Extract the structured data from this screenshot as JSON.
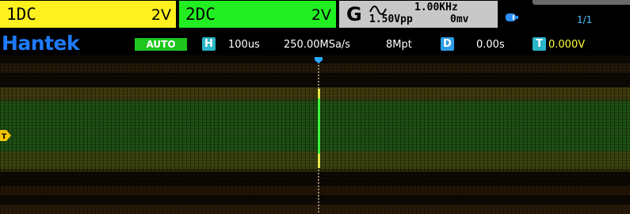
{
  "channels": [
    {
      "name": "1DC",
      "scale": "2V",
      "color": "#fff11f"
    },
    {
      "name": "2DC",
      "scale": "2V",
      "color": "#22ef22"
    }
  ],
  "generator": {
    "letter": "G",
    "wave_icon": "sine-wave-icon",
    "frequency": "1.00KHz",
    "amplitude": "1.50Vpp",
    "offset": "0mv"
  },
  "page_indicator": "1/1",
  "usb_icon": "usb-icon",
  "status": {
    "brand": "Hantek",
    "mode": "AUTO",
    "horiz_tag": "H",
    "timebase": "100us",
    "sample_rate": "250.00MSa/s",
    "memory_depth": "8Mpt",
    "delay_tag": "D",
    "delay": "0.00s",
    "trigger_tag": "T",
    "trigger_level": "0.000V"
  },
  "markers": {
    "trigger_position_icon": "trigger-position-marker-icon",
    "trigger_level_icon": "trigger-level-marker-icon",
    "trigger_level_letter": "T"
  },
  "colors": {
    "ch1": "#fff11f",
    "ch2": "#22ef22",
    "brand": "#1e7bff",
    "auto": "#1ec61e",
    "trigger_level": "#ffff30",
    "trigger_cursor": "#22ff22"
  }
}
